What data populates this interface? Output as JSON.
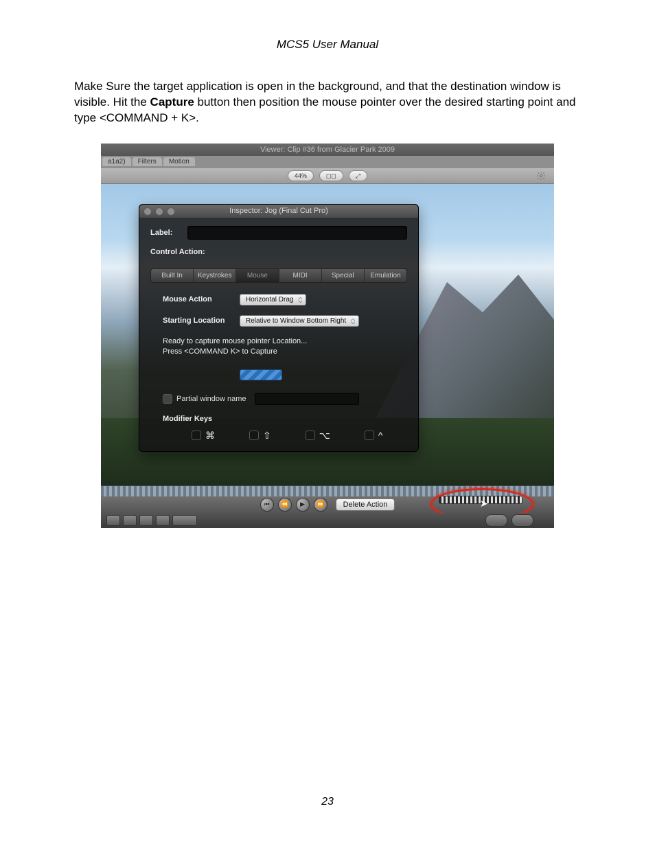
{
  "doc": {
    "header": "MCS5 User Manual",
    "para_a": "Make Sure the target application is open in the background, and that the destination window is visible. Hit the ",
    "para_b": "Capture",
    "para_c": " button then position the mouse pointer over the desired starting point and type <COMMAND + K>.",
    "page_number": "23"
  },
  "viewer": {
    "title": "Viewer: Clip #36 from Glacier Park 2009",
    "tab1": "a1a2)",
    "tab2": "Filters",
    "tab3": "Motion",
    "zoom": "44%"
  },
  "panel": {
    "title": "Inspector: Jog (Final Cut Pro)",
    "label_field": "Label:",
    "control_action": "Control Action:",
    "tabs": {
      "builtin": "Built In",
      "keystrokes": "Keystrokes",
      "mouse": "Mouse",
      "midi": "MIDI",
      "special": "Special",
      "emulation": "Emulation"
    },
    "mouse_action_label": "Mouse Action",
    "mouse_action_value": "Horizontal Drag",
    "starting_location_label": "Starting Location",
    "starting_location_value": "Relative to Window Bottom Right",
    "status1": "Ready to capture mouse pointer Location...",
    "status2": "Press <COMMAND K> to Capture",
    "partial_window": "Partial window name",
    "modifier_keys": "Modifier Keys",
    "mod_cmd": "⌘",
    "mod_shift": "⇧",
    "mod_option": "⌥",
    "mod_ctrl": "^"
  },
  "actions": {
    "delete": "Delete Action"
  }
}
